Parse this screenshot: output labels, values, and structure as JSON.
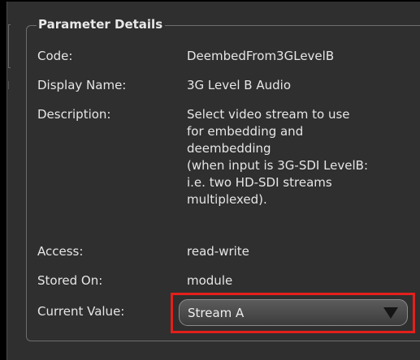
{
  "group": {
    "legend": "Parameter Details"
  },
  "fields": {
    "code": {
      "label": "Code:",
      "value": "DeembedFrom3GLevelB"
    },
    "display_name": {
      "label": "Display Name:",
      "value": "3G Level B Audio"
    },
    "description": {
      "label": "Description:",
      "value_lines": [
        "Select video stream to use",
        "for embedding and",
        "deembedding",
        "(when input is 3G-SDI LevelB:",
        "i.e. two HD-SDI streams",
        "multiplexed)."
      ]
    },
    "access": {
      "label": "Access:",
      "value": "read-write"
    },
    "stored_on": {
      "label": "Stored On:",
      "value": "module"
    },
    "current_value": {
      "label": "Current Value:",
      "selected": "Stream A"
    }
  },
  "colors": {
    "background": "#2f2f2f",
    "text": "#e6e6e6",
    "highlight": "#e3201b"
  },
  "icons": {
    "dropdown": "triangle-down-icon"
  }
}
